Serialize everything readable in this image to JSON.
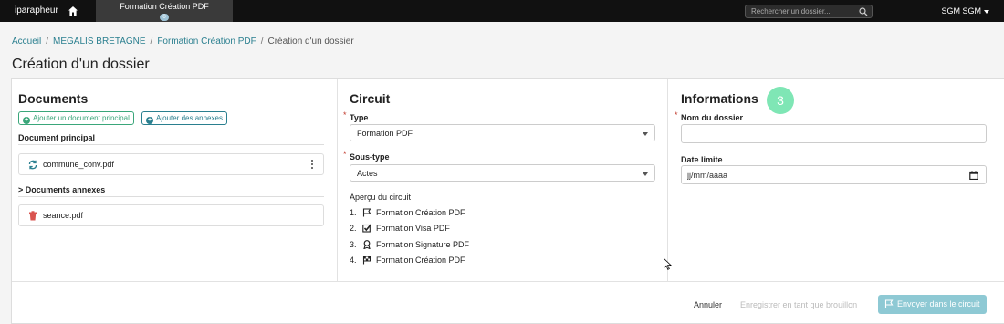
{
  "topbar": {
    "brand": "iparapheur",
    "home_icon": "home-icon",
    "tab": {
      "label": "Formation Création PDF",
      "badge": "0"
    },
    "search": {
      "placeholder": "Rechercher un dossier...",
      "value": ""
    },
    "user": "SGM SGM"
  },
  "breadcrumb": {
    "items": [
      "Accueil",
      "MEGALIS BRETAGNE",
      "Formation Création PDF",
      "Création d'un dossier"
    ]
  },
  "page_title": "Création d'un dossier",
  "documents": {
    "title": "Documents",
    "add_main_button": "Ajouter un document principal",
    "add_annex_button": "Ajouter des annexes",
    "main_heading": "Document principal",
    "main_file": {
      "name": "commune_conv.pdf",
      "icon": "sync-icon"
    },
    "annex_heading": "> Documents annexes",
    "annex_file": {
      "name": "seance.pdf",
      "icon": "trash-icon"
    }
  },
  "circuit": {
    "title": "Circuit",
    "type_label": "Type",
    "type_value": "Formation PDF",
    "subtype_label": "Sous-type",
    "subtype_value": "Actes",
    "preview_title": "Aperçu du circuit",
    "steps": [
      {
        "num": "1.",
        "label": "Formation Création PDF",
        "icon": "flag-icon"
      },
      {
        "num": "2.",
        "label": "Formation Visa PDF",
        "icon": "check-square-icon"
      },
      {
        "num": "3.",
        "label": "Formation Signature PDF",
        "icon": "ribbon-icon"
      },
      {
        "num": "4.",
        "label": "Formation Création PDF",
        "icon": "checkered-flag-icon"
      }
    ]
  },
  "informations": {
    "title": "Informations",
    "step_marker": "3",
    "name_label": "Nom du dossier",
    "name_value": "",
    "date_label": "Date limite",
    "date_placeholder": "jj/mm/aaaa"
  },
  "footer": {
    "cancel": "Annuler",
    "save_draft": "Enregistrer en tant que brouillon",
    "send": "Envoyer dans le circuit"
  },
  "colors": {
    "topbar": "#111111",
    "link": "#2a7f8f",
    "green": "#3aa67a",
    "required": "#c0392b",
    "send_button": "#8ec9d4",
    "step_marker": "#7fe6b5"
  }
}
